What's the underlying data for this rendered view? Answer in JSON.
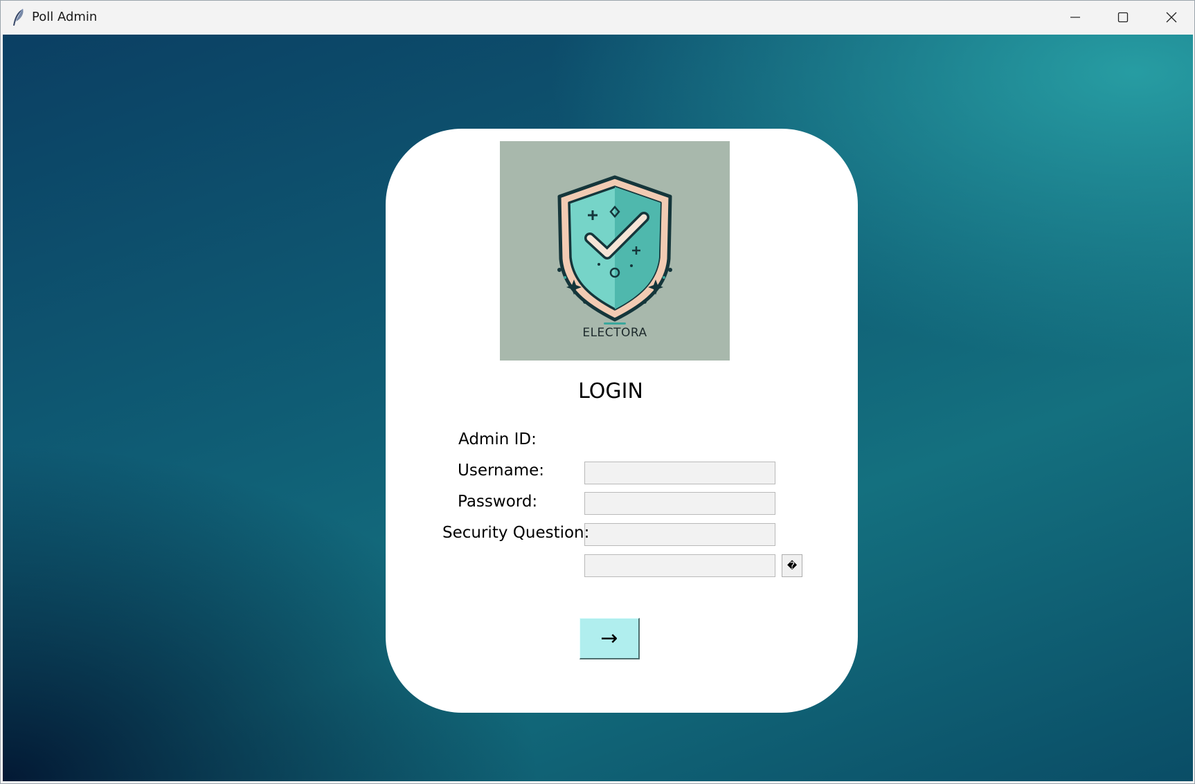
{
  "window": {
    "title": "Poll Admin",
    "icon": "feather-icon",
    "controls": [
      "minimize-icon",
      "maximize-icon",
      "close-icon"
    ]
  },
  "logo": {
    "text": "ELECTORA",
    "icon": "shield-checkmark-icon",
    "background": "#a8b8ac"
  },
  "login": {
    "title": "LOGIN",
    "fields": [
      {
        "label": "Admin ID:",
        "value": ""
      },
      {
        "label": "Username:",
        "value": ""
      },
      {
        "label": "Password:",
        "value": ""
      },
      {
        "label": "Security Question:",
        "value": ""
      }
    ],
    "help_button_label": "�",
    "submit_label": "→"
  },
  "colors": {
    "background_dark": "#021430",
    "background_teal": "#28a0a5",
    "submit_button": "#b0eeee"
  }
}
